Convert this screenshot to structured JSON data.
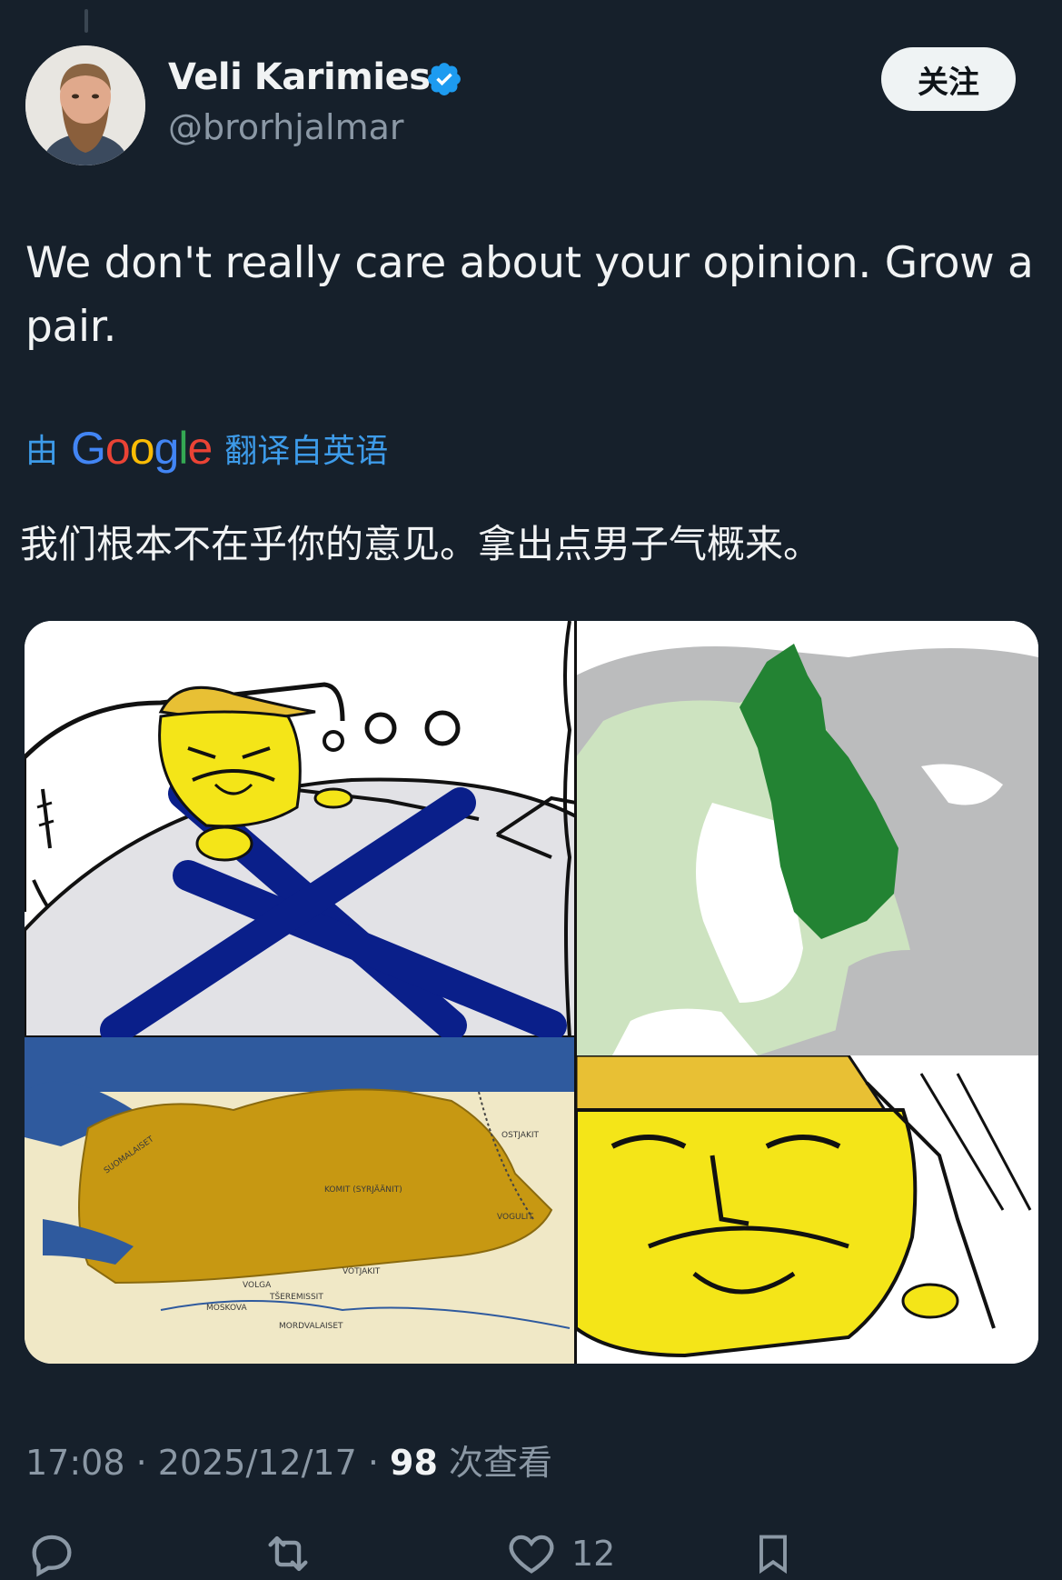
{
  "author": {
    "display_name": "Veli Karimies",
    "handle": "@brorhjalmar",
    "verified": true
  },
  "follow_button": {
    "label": "关注"
  },
  "tweet": {
    "text": "We don't really care about your opinion. Grow a pair.",
    "translation_prefix": "由",
    "translation_brand": "Google",
    "translation_suffix": "翻译自英语",
    "translated_text": "我们根本不在乎你的意见。拿出点男子气概来。"
  },
  "media": {
    "panels": [
      {
        "name": "comic-panel-sleeping"
      },
      {
        "name": "map-panel-finland"
      },
      {
        "name": "map-panel-finno-ugric",
        "labels": [
          "SUOMALAISET",
          "VOTJAKIT",
          "TŠEREMISSIT",
          "MOSKOVA",
          "MORDVALAISET",
          "VOLGA",
          "KOMIT (SYRJÄÄNIT)",
          "VOGULIT",
          "OSTJAKIT"
        ]
      },
      {
        "name": "comic-panel-smiling"
      }
    ]
  },
  "meta": {
    "time": "17:08",
    "date": "2025/12/17",
    "views": "98",
    "views_label": "次查看"
  },
  "actions": {
    "reply_count": "",
    "retweet_count": "",
    "like_count": "12"
  },
  "colors": {
    "background": "#16202b",
    "verified_blue": "#1d9bf0",
    "link_blue": "#3d9be9",
    "muted_text": "#8b98a5"
  }
}
